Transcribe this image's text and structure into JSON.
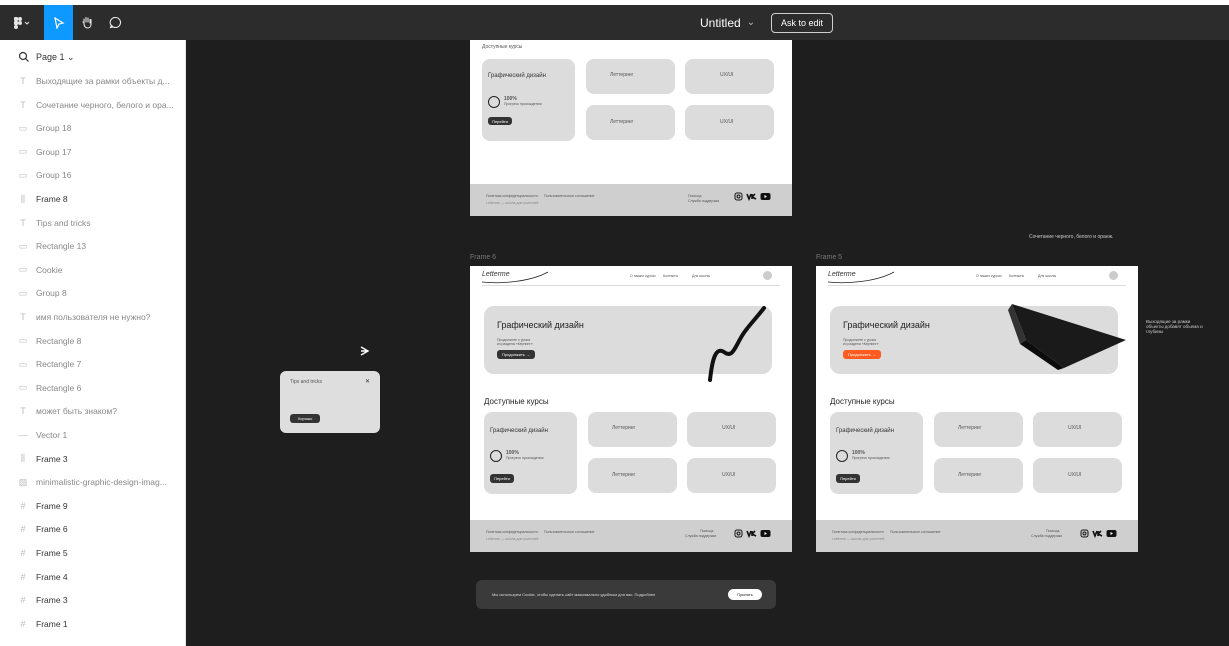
{
  "toolbar": {
    "logo_icon": "figma-logo-icon",
    "title": "Untitled",
    "title_chevron": "⌄",
    "ask_label": "Ask to edit",
    "active_color": "#0d99ff"
  },
  "panel": {
    "page_label": "Page 1 ⌄",
    "layers": [
      {
        "label": "Выходящие за рамки объекты д...",
        "icon": "T",
        "bold": false
      },
      {
        "label": "Сочетание черного, белого и ора...",
        "icon": "T",
        "bold": false
      },
      {
        "label": "Group 18",
        "icon": "▭",
        "bold": false
      },
      {
        "label": "Group 17",
        "icon": "▭",
        "bold": false
      },
      {
        "label": "Group 16",
        "icon": "▭",
        "bold": false
      },
      {
        "label": "Frame 8",
        "icon": "⫼",
        "bold": true
      },
      {
        "label": "Tips and tricks",
        "icon": "T",
        "bold": false
      },
      {
        "label": "Rectangle 13",
        "icon": "▭",
        "bold": false
      },
      {
        "label": "Cookie",
        "icon": "▭",
        "bold": false
      },
      {
        "label": "Group 8",
        "icon": "▭",
        "bold": false
      },
      {
        "label": "имя пользователя не нужно?",
        "icon": "T",
        "bold": false
      },
      {
        "label": "Rectangle 8",
        "icon": "▭",
        "bold": false
      },
      {
        "label": "Rectangle 7",
        "icon": "▭",
        "bold": false
      },
      {
        "label": "Rectangle 6",
        "icon": "▭",
        "bold": false
      },
      {
        "label": "может быть знаком?",
        "icon": "T",
        "bold": false
      },
      {
        "label": "Vector 1",
        "icon": "—",
        "bold": false
      },
      {
        "label": "Frame 3",
        "icon": "⫼",
        "bold": true
      },
      {
        "label": "minimalistic-graphic-design-imag...",
        "icon": "▨",
        "bold": false
      },
      {
        "label": "Frame 9",
        "icon": "#",
        "bold": true
      },
      {
        "label": "Frame 6",
        "icon": "#",
        "bold": true
      },
      {
        "label": "Frame 5",
        "icon": "#",
        "bold": true
      },
      {
        "label": "Frame 4",
        "icon": "#",
        "bold": true
      },
      {
        "label": "Frame 3",
        "icon": "#",
        "bold": true
      },
      {
        "label": "Frame 1",
        "icon": "#",
        "bold": true
      }
    ]
  },
  "canvas": {
    "frame6_label": "Frame 6",
    "frame5_label": "Frame 5",
    "note_right_1": "Сочетание черного, белого и оранж.",
    "note_right_2": "Выходящие за рамки объекты добавят объема и глубины",
    "top_frame": {
      "section": "Доступные курсы",
      "card1_title": "Графический дизайн",
      "card1_pct": "100%",
      "card1_sub": "Прогресс прохождения",
      "card1_btn": "Перейти",
      "card2": "Леттеринг",
      "card3": "UX/UI",
      "card4": "Леттеринг",
      "card5": "UX/UI",
      "footer_left_1": "Политика конфиденциальности",
      "footer_left_2": "Пользовательское соглашение",
      "footer_left_3": "Letterme — школа для учителей",
      "footer_right_1": "Помощь",
      "footer_right_2": "Служба поддержки"
    },
    "frame_common": {
      "logo": "Letterme",
      "nav_1": "О наших курсах",
      "nav_2": "Контакты",
      "nav_3": "Для школы",
      "hero": "Графический дизайн",
      "hero_sub_1": "Продолжите с урока",
      "hero_sub_2": "из раздела «Кернинг»",
      "hero_btn": "Продолжить →",
      "section": "Доступные курсы",
      "card1_title": "Графический дизайн",
      "card1_pct": "100%",
      "card1_sub": "Прогресс прохождения",
      "card1_btn": "Перейти",
      "card2": "Леттеринг",
      "card3": "UX/UI",
      "card4": "Леттеринг",
      "card5": "UX/UI",
      "footer_left_1": "Политика конфиденциальности",
      "footer_left_2": "Пользовательское соглашение",
      "footer_left_3": "Letterme — школа для учителей",
      "footer_right_1": "Помощь",
      "footer_right_2": "Служба поддержки"
    },
    "popup": {
      "title": "Tips and tricks",
      "close": "✕",
      "btn": "Хорошо"
    },
    "cookie": {
      "text": "Мы используем Cookie, чтобы сделать сайт максимально удобным для вас. Подробнее",
      "btn": "Принять"
    },
    "orange": "#ff5a1f"
  }
}
